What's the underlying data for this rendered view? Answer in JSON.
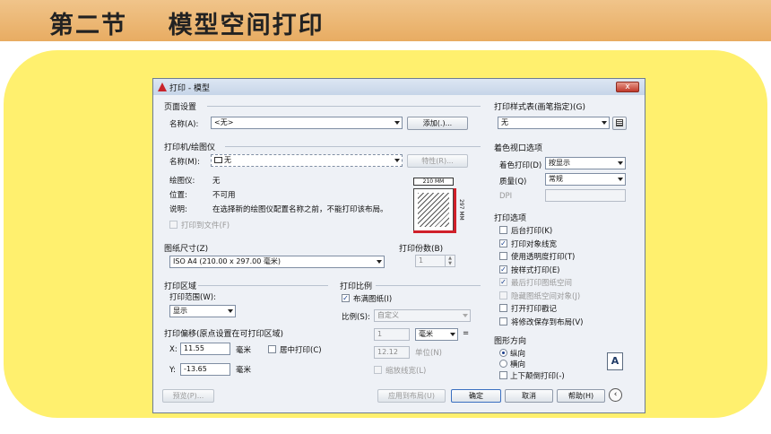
{
  "slide": {
    "title": "第二节    模型空间打印"
  },
  "dialog": {
    "title": "打印 - 模型",
    "close_label": "x",
    "page_setup": {
      "section": "页面设置",
      "name_label": "名称(A):",
      "name_value": "<无>",
      "add_button": "添加(.)..."
    },
    "printer": {
      "section": "打印机/绘图仪",
      "name_label": "名称(M):",
      "name_value": "无",
      "properties_button": "特性(R)...",
      "plotter_label": "绘图仪:",
      "plotter_value": "无",
      "location_label": "位置:",
      "location_value": "不可用",
      "description_label": "说明:",
      "description_value": "在选择新的绘图仪配置名称之前，不能打印该布局。",
      "print_to_file": "打印到文件(F)",
      "preview_width": "210 MM",
      "preview_height": "297 MM"
    },
    "paper_size": {
      "section": "图纸尺寸(Z)",
      "value": "ISO A4 (210.00 x 297.00 毫米)"
    },
    "copies": {
      "section": "打印份数(B)",
      "value": "1"
    },
    "plot_area": {
      "section": "打印区域",
      "range_label": "打印范围(W):",
      "range_value": "显示"
    },
    "plot_offset": {
      "section": "打印偏移(原点设置在可打印区域)",
      "x_label": "X:",
      "x_value": "11.55",
      "x_unit": "毫米",
      "y_label": "Y:",
      "y_value": "-13.65",
      "y_unit": "毫米",
      "center_label": "居中打印(C)"
    },
    "plot_scale": {
      "section": "打印比例",
      "fit_label": "布满图纸(I)",
      "scale_label": "比例(S):",
      "scale_value": "自定义",
      "value1": "1",
      "unit": "毫米",
      "equals": "=",
      "value2": "12.12",
      "unit2": "单位(N)",
      "lineweights_label": "缩放线宽(L)"
    },
    "style_table": {
      "section": "打印样式表(画笔指定)(G)",
      "value": "无"
    },
    "shaded_viewport": {
      "section": "着色视口选项",
      "shade_label": "着色打印(D)",
      "shade_value": "按显示",
      "quality_label": "质量(Q)",
      "quality_value": "常规",
      "dpi_label": "DPI"
    },
    "plot_options": {
      "section": "打印选项",
      "items": [
        {
          "label": "后台打印(K)",
          "checked": false,
          "enabled": true
        },
        {
          "label": "打印对象线宽",
          "checked": true,
          "enabled": true
        },
        {
          "label": "使用透明度打印(T)",
          "checked": false,
          "enabled": true
        },
        {
          "label": "按样式打印(E)",
          "checked": true,
          "enabled": true
        },
        {
          "label": "最后打印图纸空间",
          "checked": true,
          "enabled": false
        },
        {
          "label": "隐藏图纸空间对象(J)",
          "checked": false,
          "enabled": false
        },
        {
          "label": "打开打印戳记",
          "checked": false,
          "enabled": true
        },
        {
          "label": "将修改保存到布局(V)",
          "checked": false,
          "enabled": true
        }
      ]
    },
    "orientation": {
      "section": "图形方向",
      "portrait": "纵向",
      "landscape": "横向",
      "upside_down": "上下颠倒打印(-)",
      "icon_letter": "A"
    },
    "footer": {
      "preview": "预览(P)...",
      "apply": "应用到布局(U)",
      "ok": "确定",
      "cancel": "取消",
      "help": "帮助(H)"
    }
  }
}
